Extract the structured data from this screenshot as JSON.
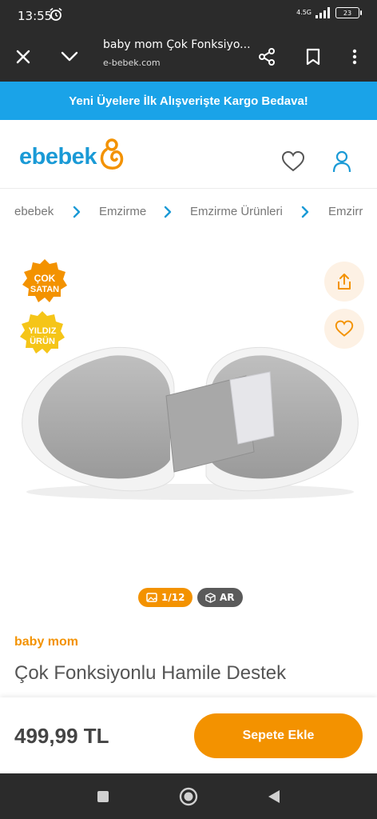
{
  "status_bar": {
    "time": "13:55",
    "network": "4.5G",
    "battery": "23"
  },
  "browser": {
    "title": "baby mom Çok Fonksiyo...",
    "url": "e-bebek.com"
  },
  "promo": {
    "text": "Yeni Üyelere İlk Alışverişte Kargo Bedava!"
  },
  "header": {
    "logo_text": "ebebek"
  },
  "breadcrumb": {
    "items": [
      "ebebek",
      "Emzirme",
      "Emzirme Ürünleri",
      "Emzirr"
    ]
  },
  "gallery": {
    "badges": [
      "ÇOK SATAN",
      "YILDIZ ÜRÜN"
    ],
    "image_counter": "1/12",
    "ar_label": "AR"
  },
  "product": {
    "brand": "baby mom",
    "title": "Çok Fonksiyonlu Hamile Destek",
    "price": "499,99 TL",
    "add_to_cart": "Sepete Ekle"
  },
  "colors": {
    "brand_blue": "#1a9ad6",
    "promo_blue": "#1aa3e8",
    "accent_orange": "#f39200",
    "dark_bar": "#2b2b2b"
  },
  "icons": [
    "alarm-icon",
    "signal-icon",
    "battery-icon",
    "close-icon",
    "chevron-down-icon",
    "share-icon",
    "bookmark-icon",
    "more-vertical-icon",
    "heart-icon",
    "user-icon",
    "chevron-right-icon",
    "upload-share-icon",
    "image-icon",
    "cube-icon",
    "square-icon",
    "circle-icon",
    "back-triangle-icon"
  ]
}
